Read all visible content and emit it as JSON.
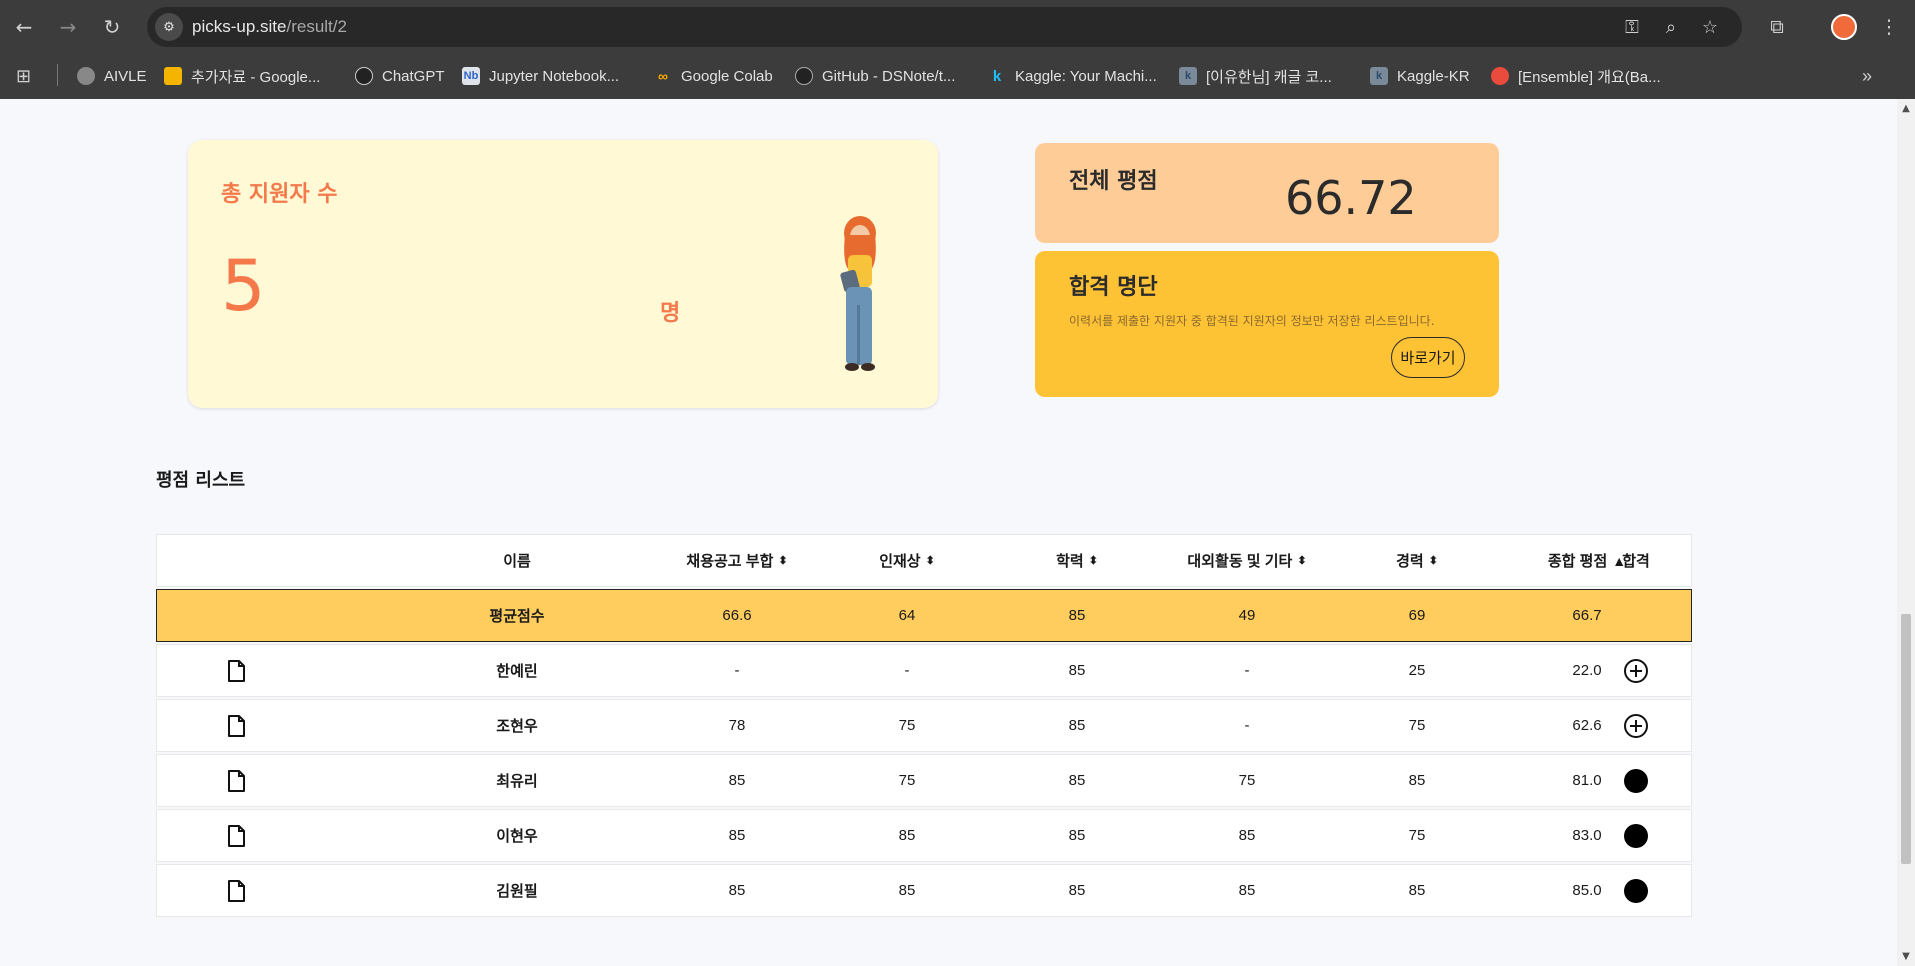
{
  "browser": {
    "url_host": "picks-up.site",
    "url_path": "/result/2",
    "bookmarks": [
      {
        "label": "AIVLE",
        "icon": "globe-icon"
      },
      {
        "label": "추가자료 - Google...",
        "icon": "google-drive-icon"
      },
      {
        "label": "ChatGPT",
        "icon": "chatgpt-icon"
      },
      {
        "label": "Jupyter Notebook...",
        "icon": "jupyter-icon"
      },
      {
        "label": "Google Colab",
        "icon": "colab-icon"
      },
      {
        "label": "GitHub - DSNote/t...",
        "icon": "github-icon"
      },
      {
        "label": "Kaggle: Your Machi...",
        "icon": "kaggle-icon"
      },
      {
        "label": "[이유한님] 캐글 코...",
        "icon": "kaggle-icon"
      },
      {
        "label": "Kaggle-KR",
        "icon": "kaggle-icon"
      },
      {
        "label": "[Ensemble] 개요(Ba...",
        "icon": "ensemble-icon"
      }
    ]
  },
  "applicants_card": {
    "title": "총 지원자 수",
    "count": "5",
    "unit": "명"
  },
  "score_card": {
    "title": "전체 평점",
    "value": "66.72"
  },
  "pass_card": {
    "title": "합격 명단",
    "description": "이력서를 제출한 지원자 중 합격된 지원자의 정보만 저장한 리스트입니다.",
    "button_label": "바로가기"
  },
  "section_title": "평점 리스트",
  "table": {
    "headers": {
      "name": "이름",
      "job_fit": "채용공고 부합",
      "talent": "인재상",
      "education": "학력",
      "activities": "대외활동 및 기타",
      "career": "경력",
      "total": "종합 평점",
      "pass": "합격"
    },
    "sort_total": "▲",
    "average": {
      "name": "평균점수",
      "job_fit": "66.6",
      "talent": "64",
      "education": "85",
      "activities": "49",
      "career": "69",
      "total": "66.7"
    },
    "rows": [
      {
        "name": "한예린",
        "job_fit": "-",
        "talent": "-",
        "education": "85",
        "activities": "-",
        "career": "25",
        "total": "22.0",
        "pass_icon": "plus-circle-icon"
      },
      {
        "name": "조현우",
        "job_fit": "78",
        "talent": "75",
        "education": "85",
        "activities": "-",
        "career": "75",
        "total": "62.6",
        "pass_icon": "plus-circle-icon"
      },
      {
        "name": "최유리",
        "job_fit": "85",
        "talent": "75",
        "education": "85",
        "activities": "75",
        "career": "85",
        "total": "81.0",
        "pass_icon": "filled-circle-icon"
      },
      {
        "name": "이현우",
        "job_fit": "85",
        "talent": "85",
        "education": "85",
        "activities": "85",
        "career": "75",
        "total": "83.0",
        "pass_icon": "filled-circle-icon"
      },
      {
        "name": "김원필",
        "job_fit": "85",
        "talent": "85",
        "education": "85",
        "activities": "85",
        "career": "85",
        "total": "85.0",
        "pass_icon": "filled-circle-icon"
      }
    ]
  }
}
